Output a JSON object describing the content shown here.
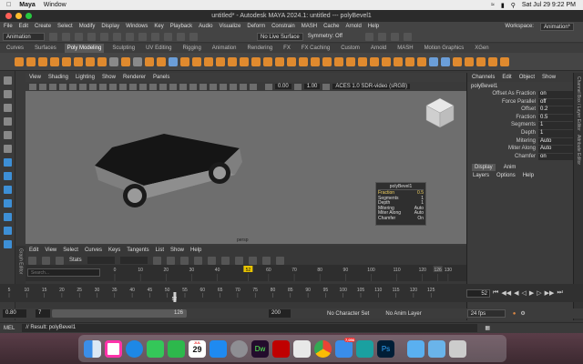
{
  "mac_menubar": {
    "app": "Maya",
    "items": [
      "Window"
    ],
    "clock": "Sat Jul 29  9:22 PM"
  },
  "window": {
    "title": "untitled* - Autodesk MAYA 2024.1: untitled   ---   polyBevel1"
  },
  "menubar": {
    "items": [
      "File",
      "Edit",
      "Create",
      "Select",
      "Modify",
      "Display",
      "Windows",
      "Key",
      "Playback",
      "Audio",
      "Visualize",
      "Deform",
      "Constrain",
      "MASH",
      "Cache",
      "Arnold",
      "Help"
    ],
    "workspace_label": "Workspace:",
    "workspace_value": "Animation*"
  },
  "statusline": {
    "mode": "Animation",
    "live_surface": "No Live Surface",
    "symmetry": "Symmetry: Off"
  },
  "shelf_tabs": [
    "Curves",
    "Surfaces",
    "Poly Modeling",
    "Sculpting",
    "UV Editing",
    "Rigging",
    "Animation",
    "Rendering",
    "FX",
    "FX Caching",
    "Custom",
    "Arnold",
    "MASH",
    "Motion Graphics",
    "XGen"
  ],
  "shelf_active": "Poly Modeling",
  "viewport": {
    "menus": [
      "View",
      "Shading",
      "Lighting",
      "Show",
      "Renderer",
      "Panels"
    ],
    "gamma_value": "0.00",
    "exposure_value": "1.00",
    "colorspace": "ACES 1.0 SDR-video (sRGB)",
    "camera_label": "persp",
    "cube_label": "FRONT"
  },
  "hud": {
    "title": "polyBevel1",
    "rows": [
      {
        "name": "Fraction",
        "value": "0.5"
      },
      {
        "name": "Segments",
        "value": "1"
      },
      {
        "name": "Depth",
        "value": "1"
      },
      {
        "name": "Mitering",
        "value": "Auto"
      },
      {
        "name": "Miter Along",
        "value": "Auto"
      },
      {
        "name": "Chamfer",
        "value": "On"
      }
    ]
  },
  "channel_box": {
    "tabs": [
      "Channels",
      "Edit",
      "Object",
      "Show"
    ],
    "object": "polyBevel1",
    "attributes": [
      {
        "name": "Offset As Fraction",
        "value": "on"
      },
      {
        "name": "Force Parallel",
        "value": "off"
      },
      {
        "name": "Offset",
        "value": "0.2"
      },
      {
        "name": "Fraction",
        "value": "0.5"
      },
      {
        "name": "Segments",
        "value": "1"
      },
      {
        "name": "Depth",
        "value": "1"
      },
      {
        "name": "Mitering",
        "value": "Auto"
      },
      {
        "name": "Miter Along",
        "value": "Auto"
      },
      {
        "name": "Chamfer",
        "value": "on"
      }
    ],
    "layer_tabs": [
      "Display",
      "Anim"
    ],
    "layer_active": "Display",
    "layer_menu": [
      "Layers",
      "Options",
      "Help"
    ],
    "side_tabs": [
      "Channel Box / Layer Editor",
      "Attribute Editor"
    ]
  },
  "graph_editor": {
    "menus": [
      "Edit",
      "View",
      "Select",
      "Curves",
      "Keys",
      "Tangents",
      "List",
      "Show",
      "Help"
    ],
    "stats_label": "Stats",
    "search_placeholder": "Search...",
    "ruler": [
      "0",
      "10",
      "20",
      "30",
      "40",
      "52",
      "60",
      "70",
      "80",
      "90",
      "100",
      "110",
      "120",
      "126",
      "130"
    ],
    "frame_marker": "52",
    "end_marker": "126",
    "side_label": "Graph Editor"
  },
  "timeline": {
    "ticks": [
      "5",
      "10",
      "15",
      "20",
      "25",
      "30",
      "35",
      "40",
      "45",
      "50",
      "55",
      "60",
      "65",
      "70",
      "75",
      "80",
      "85",
      "90",
      "95",
      "100",
      "105",
      "110",
      "115",
      "120",
      "125"
    ],
    "current_frame": "52",
    "current_frame_field": "52"
  },
  "range": {
    "start": "0.80",
    "inner_start": "7",
    "inner_end": "126",
    "end": "200",
    "character_set": "No Character Set",
    "anim_layer": "No Anim Layer",
    "fps": "24 fps"
  },
  "command": {
    "lang": "MEL",
    "result": "// Result: polyBevel1"
  },
  "dock": {
    "calendar_month": "JUL",
    "calendar_day": "29",
    "mail_badge": "7,056"
  }
}
